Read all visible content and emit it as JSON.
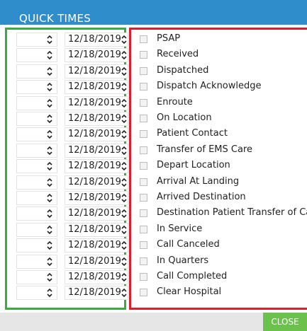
{
  "dialog": {
    "title": "QUICK TIMES",
    "close_label": "CLOSE"
  },
  "rows": [
    {
      "time": "",
      "date": "12/18/2019",
      "label": "PSAP",
      "checked": false
    },
    {
      "time": "",
      "date": "12/18/2019",
      "label": "Received",
      "checked": false
    },
    {
      "time": "",
      "date": "12/18/2019",
      "label": "Dispatched",
      "checked": false
    },
    {
      "time": "",
      "date": "12/18/2019",
      "label": "Dispatch Acknowledge",
      "checked": false
    },
    {
      "time": "",
      "date": "12/18/2019",
      "label": "Enroute",
      "checked": false
    },
    {
      "time": "",
      "date": "12/18/2019",
      "label": "On Location",
      "checked": false
    },
    {
      "time": "",
      "date": "12/18/2019",
      "label": "Patient Contact",
      "checked": false
    },
    {
      "time": "",
      "date": "12/18/2019",
      "label": "Transfer of EMS Care",
      "checked": false
    },
    {
      "time": "",
      "date": "12/18/2019",
      "label": "Depart Location",
      "checked": false
    },
    {
      "time": "",
      "date": "12/18/2019",
      "label": "Arrival At Landing",
      "checked": false
    },
    {
      "time": "",
      "date": "12/18/2019",
      "label": "Arrived Destination",
      "checked": false
    },
    {
      "time": "",
      "date": "12/18/2019",
      "label": "Destination Patient Transfer of Care",
      "checked": false
    },
    {
      "time": "",
      "date": "12/18/2019",
      "label": "In Service",
      "checked": false
    },
    {
      "time": "",
      "date": "12/18/2019",
      "label": "Call Canceled",
      "checked": false
    },
    {
      "time": "",
      "date": "12/18/2019",
      "label": "In Quarters",
      "checked": false
    },
    {
      "time": "",
      "date": "12/18/2019",
      "label": "Call Completed",
      "checked": false
    },
    {
      "time": "",
      "date": "12/18/2019",
      "label": "Clear Hospital",
      "checked": false
    }
  ],
  "colors": {
    "title_bar": "#2f8dcc",
    "time_panel_border": "#3aab3f",
    "event_panel_border": "#e11d2b",
    "close_button": "#6bc14b"
  }
}
